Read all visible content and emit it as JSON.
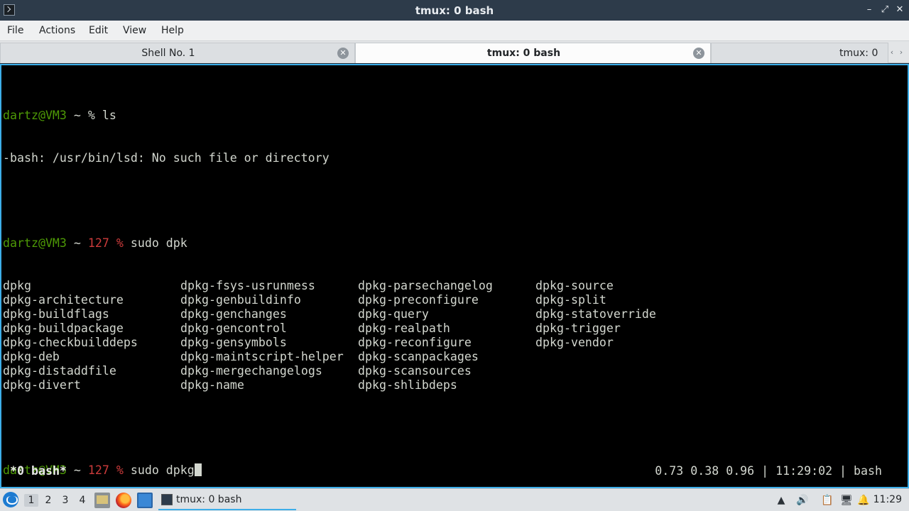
{
  "window": {
    "title": "tmux: 0 bash",
    "minimize_glyph": "–",
    "maximize_glyph": "⤢",
    "close_glyph": "✕"
  },
  "menu": [
    "File",
    "Actions",
    "Edit",
    "View",
    "Help"
  ],
  "tabs": [
    {
      "label": "Shell No. 1",
      "active": false
    },
    {
      "label": "tmux: 0 bash",
      "active": true
    },
    {
      "label": "tmux: 0",
      "active": false
    }
  ],
  "terminal": {
    "line1": {
      "user": "dartz@VM3",
      "rest": " ~ % ls"
    },
    "line2": "-bash: /usr/bin/lsd: No such file or directory",
    "line3": {
      "user": "dartz@VM3",
      "mid": " ~ ",
      "code": "127 %",
      "cmd": " sudo dpk"
    },
    "completions": [
      [
        "dpkg",
        "dpkg-fsys-usrunmess",
        "dpkg-parsechangelog",
        "dpkg-source"
      ],
      [
        "dpkg-architecture",
        "dpkg-genbuildinfo",
        "dpkg-preconfigure",
        "dpkg-split"
      ],
      [
        "dpkg-buildflags",
        "dpkg-genchanges",
        "dpkg-query",
        "dpkg-statoverride"
      ],
      [
        "dpkg-buildpackage",
        "dpkg-gencontrol",
        "dpkg-realpath",
        "dpkg-trigger"
      ],
      [
        "dpkg-checkbuilddeps",
        "dpkg-gensymbols",
        "dpkg-reconfigure",
        "dpkg-vendor"
      ],
      [
        "dpkg-deb",
        "dpkg-maintscript-helper",
        "dpkg-scanpackages",
        ""
      ],
      [
        "dpkg-distaddfile",
        "dpkg-mergechangelogs",
        "dpkg-scansources",
        ""
      ],
      [
        "dpkg-divert",
        "dpkg-name",
        "dpkg-shlibdeps",
        ""
      ]
    ],
    "line4": {
      "user": "dartz@VM3",
      "mid": " ~ ",
      "code": "127 %",
      "cmd": " sudo dpkg"
    },
    "status_left": "*0 bash*",
    "status_right": "0.73 0.38 0.96 | 11:29:02 | bash"
  },
  "taskbar": {
    "workspaces": [
      "1",
      "2",
      "3",
      "4"
    ],
    "active_workspace": "1",
    "task_label": "tmux: 0 bash",
    "clock": "11:29"
  },
  "colors": {
    "accent": "#3daee9",
    "prompt_user": "#4e9a06",
    "exit_code": "#cc3b3b",
    "terminal_bg": "#000000"
  }
}
